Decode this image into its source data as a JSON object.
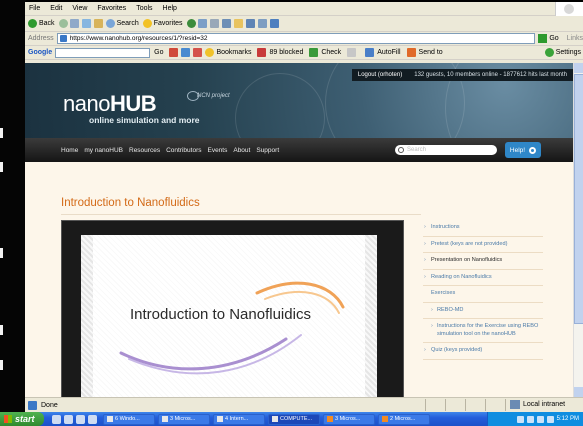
{
  "browser": {
    "menu": [
      "File",
      "Edit",
      "View",
      "Favorites",
      "Tools",
      "Help"
    ],
    "toolbar": {
      "back": "Back",
      "search": "Search",
      "favorites": "Favorites"
    },
    "address": {
      "label": "Address",
      "url": "https://www.nanohub.org/resources/1/?resid=32",
      "go": "Go",
      "links": "Links"
    },
    "google": {
      "logo": "Google",
      "go": "Go",
      "bookmarks": "Bookmarks",
      "blocked": "89 blocked",
      "check": "Check",
      "autofill": "AutoFill",
      "send_to": "Send to",
      "settings": "Settings"
    },
    "status": {
      "text": "Done",
      "zone": "Local intranet"
    }
  },
  "site": {
    "login": {
      "logout": "Logout (orhoten)",
      "stats": "132 guests, 10 members online - 1877612 hits last month"
    },
    "logo": {
      "light": "nano",
      "bold": "HUB"
    },
    "ncn": "NCN project",
    "tagline": "online simulation and more",
    "nav": [
      "Home",
      "my nanoHUB",
      "Resources",
      "Contributors",
      "Events",
      "About",
      "Support"
    ],
    "search_placeholder": "Search",
    "help": "Help!"
  },
  "page": {
    "title": "Introduction to Nanofluidics",
    "slide_title": "Introduction to Nanofluidics"
  },
  "sidebar": {
    "items": [
      {
        "label": "Instructions",
        "type": "link"
      },
      {
        "label": "Pretest (keys are not provided)",
        "type": "link"
      },
      {
        "label": "Presentation on Nanofluidics",
        "type": "active"
      },
      {
        "label": "Reading on Nanofluidics",
        "type": "link"
      },
      {
        "label": "Exercises",
        "type": "heading"
      },
      {
        "label": "REBO-MD",
        "type": "sub"
      },
      {
        "label": "Instructions for the Exercise using REBO simulation tool on the nanoHUB",
        "type": "sub"
      },
      {
        "label": "Quiz (keys provided)",
        "type": "link"
      }
    ]
  },
  "taskbar": {
    "start": "start",
    "tasks": [
      "6 Windo...",
      "3 Micros...",
      "4 Intern...",
      "COMPUTE...",
      "3 Micros...",
      "2 Micros..."
    ],
    "clock": "5:12 PM"
  },
  "colors": {
    "title_orange": "#d36a17",
    "link_blue": "#4a7aa8",
    "help_blue": "#2f87c8"
  }
}
